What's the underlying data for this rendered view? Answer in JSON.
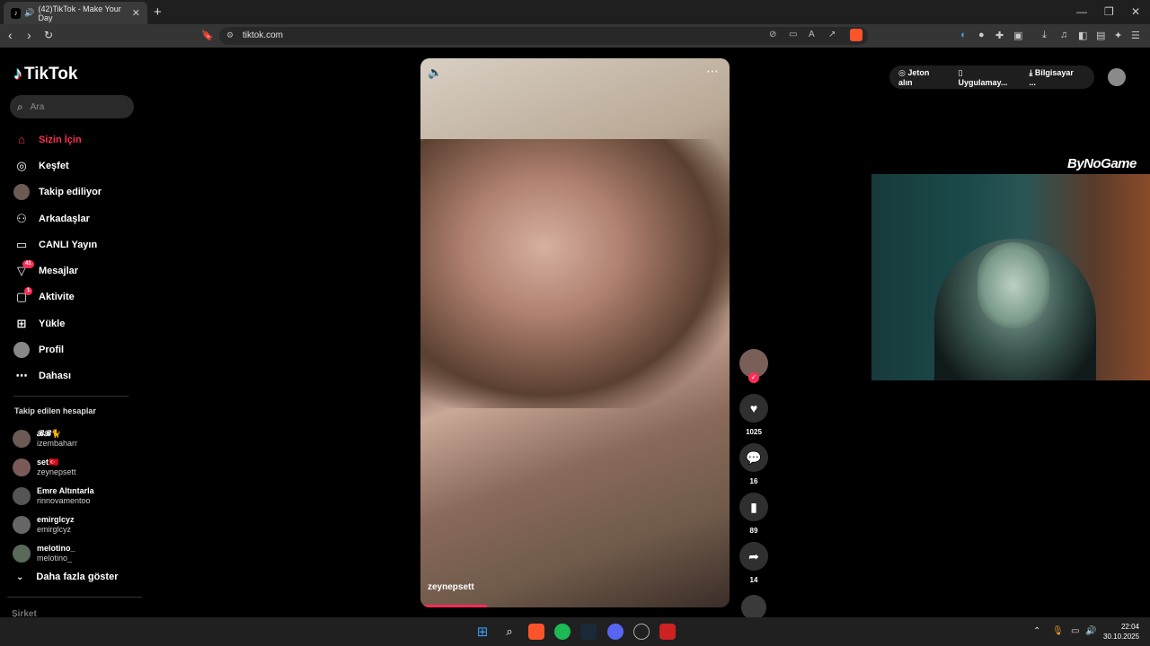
{
  "browser": {
    "tab_title": "(42)TikTok - Make Your Day",
    "tab_close": "✕",
    "new_tab": "+",
    "url": "tiktok.com",
    "window": {
      "minimize": "—",
      "restore": "❐",
      "close": "✕"
    }
  },
  "sidebar": {
    "logo": "TikTok",
    "search_placeholder": "Ara",
    "items": [
      {
        "label": "Sizin İçin",
        "icon": "home-icon",
        "glyph": "⌂"
      },
      {
        "label": "Keşfet",
        "icon": "compass-icon",
        "glyph": "◎"
      },
      {
        "label": "Takip ediliyor",
        "icon": "following-avatar-icon",
        "glyph": "●"
      },
      {
        "label": "Arkadaşlar",
        "icon": "friends-icon",
        "glyph": "👥"
      },
      {
        "label": "CANLI Yayın",
        "icon": "live-tv-icon",
        "glyph": "📺"
      },
      {
        "label": "Mesajlar",
        "icon": "messages-icon",
        "glyph": "▽",
        "badge": "41"
      },
      {
        "label": "Aktivite",
        "icon": "activity-icon",
        "glyph": "▢",
        "badge": "1"
      },
      {
        "label": "Yükle",
        "icon": "upload-icon",
        "glyph": "⊞"
      },
      {
        "label": "Profil",
        "icon": "profile-icon",
        "glyph": "●"
      },
      {
        "label": "Dahası",
        "icon": "more-dots-icon",
        "glyph": "⋯"
      }
    ],
    "following_title": "Takip edilen hesaplar",
    "accounts": [
      {
        "display": "𝓑𝓑🐈",
        "handle": "izembaharr"
      },
      {
        "display": "set🇹🇷",
        "handle": "zeynepsett"
      },
      {
        "display": "Emre Altıntarla",
        "handle": "rinnovamentoo"
      },
      {
        "display": "emirglcyz",
        "handle": "emirglcyz"
      },
      {
        "display": "melotino_",
        "handle": "melotino_"
      }
    ],
    "show_more": "Daha fazla göster",
    "company": "Şirket"
  },
  "video": {
    "username": "zeynepsett",
    "likes": "1025",
    "comments": "16",
    "saves": "89",
    "shares": "14"
  },
  "topbar": {
    "coins": "Jeton alın",
    "app": "Uygulamay...",
    "desktop": "Bilgisayar ..."
  },
  "overlay": {
    "brand": "ByNoGame"
  },
  "taskbar": {
    "time": "22:04",
    "date": "30.10.2025"
  }
}
